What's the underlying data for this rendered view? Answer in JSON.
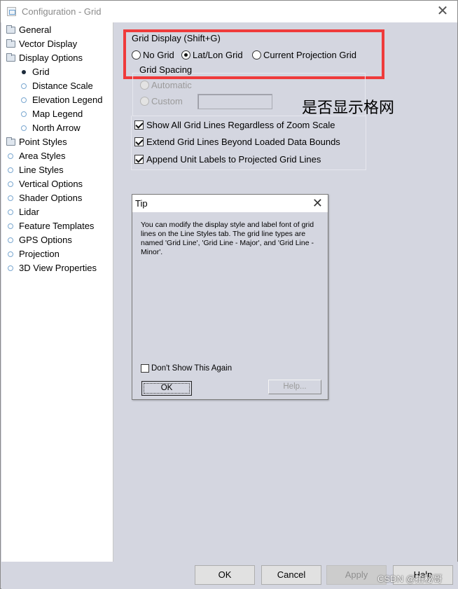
{
  "window": {
    "title": "Configuration - Grid"
  },
  "sidebar": {
    "items": [
      {
        "label": "General",
        "icon": "folder-icon"
      },
      {
        "label": "Vector Display",
        "icon": "folder-icon"
      },
      {
        "label": "Display Options",
        "icon": "folder-open-icon"
      },
      {
        "label": "Grid",
        "icon": "bullet-icon",
        "selected": true
      },
      {
        "label": "Distance Scale",
        "icon": "circle-icon"
      },
      {
        "label": "Elevation Legend",
        "icon": "circle-icon"
      },
      {
        "label": "Map Legend",
        "icon": "circle-icon"
      },
      {
        "label": "North Arrow",
        "icon": "circle-icon"
      },
      {
        "label": "Point Styles",
        "icon": "folder-icon"
      },
      {
        "label": "Area Styles",
        "icon": "circle-icon"
      },
      {
        "label": "Line Styles",
        "icon": "circle-icon"
      },
      {
        "label": "Vertical Options",
        "icon": "circle-icon"
      },
      {
        "label": "Shader Options",
        "icon": "circle-icon"
      },
      {
        "label": "Lidar",
        "icon": "circle-icon"
      },
      {
        "label": "Feature Templates",
        "icon": "circle-icon"
      },
      {
        "label": "GPS Options",
        "icon": "circle-icon"
      },
      {
        "label": "Projection",
        "icon": "circle-icon"
      },
      {
        "label": "3D View Properties",
        "icon": "circle-icon"
      }
    ]
  },
  "grid_panel": {
    "group_title": "Grid Display (Shift+G)",
    "display_options": [
      {
        "label": "No Grid",
        "checked": false
      },
      {
        "label": "Lat/Lon Grid",
        "checked": true
      },
      {
        "label": "Current Projection Grid",
        "checked": false
      }
    ],
    "spacing_title": "Grid Spacing",
    "spacing_options": [
      {
        "label": "Automatic",
        "enabled": false
      },
      {
        "label": "Custom",
        "enabled": false
      }
    ],
    "custom_value": "",
    "annotation": "是否显示格网",
    "annotation_box_color": "#ef3b3b",
    "checkboxes": [
      {
        "label": "Show All Grid Lines Regardless of Zoom Scale",
        "checked": true
      },
      {
        "label": "Extend Grid Lines Beyond Loaded Data Bounds",
        "checked": true
      },
      {
        "label": "Append Unit Labels to Projected Grid Lines",
        "checked": true
      }
    ]
  },
  "tip_dialog": {
    "title": "Tip",
    "message": "You can modify the display style and label font of grid lines on the Line Styles tab. The grid line types are named 'Grid Line', 'Grid Line - Major', and 'Grid Line - Minor'.",
    "dont_show_label": "Don't Show This Again",
    "ok_label": "OK",
    "help_label": "Help..."
  },
  "footer": {
    "ok_label": "OK",
    "cancel_label": "Cancel",
    "apply_label": "Apply",
    "help_label": "Help"
  },
  "watermark": "CSDN @拍秘哥"
}
